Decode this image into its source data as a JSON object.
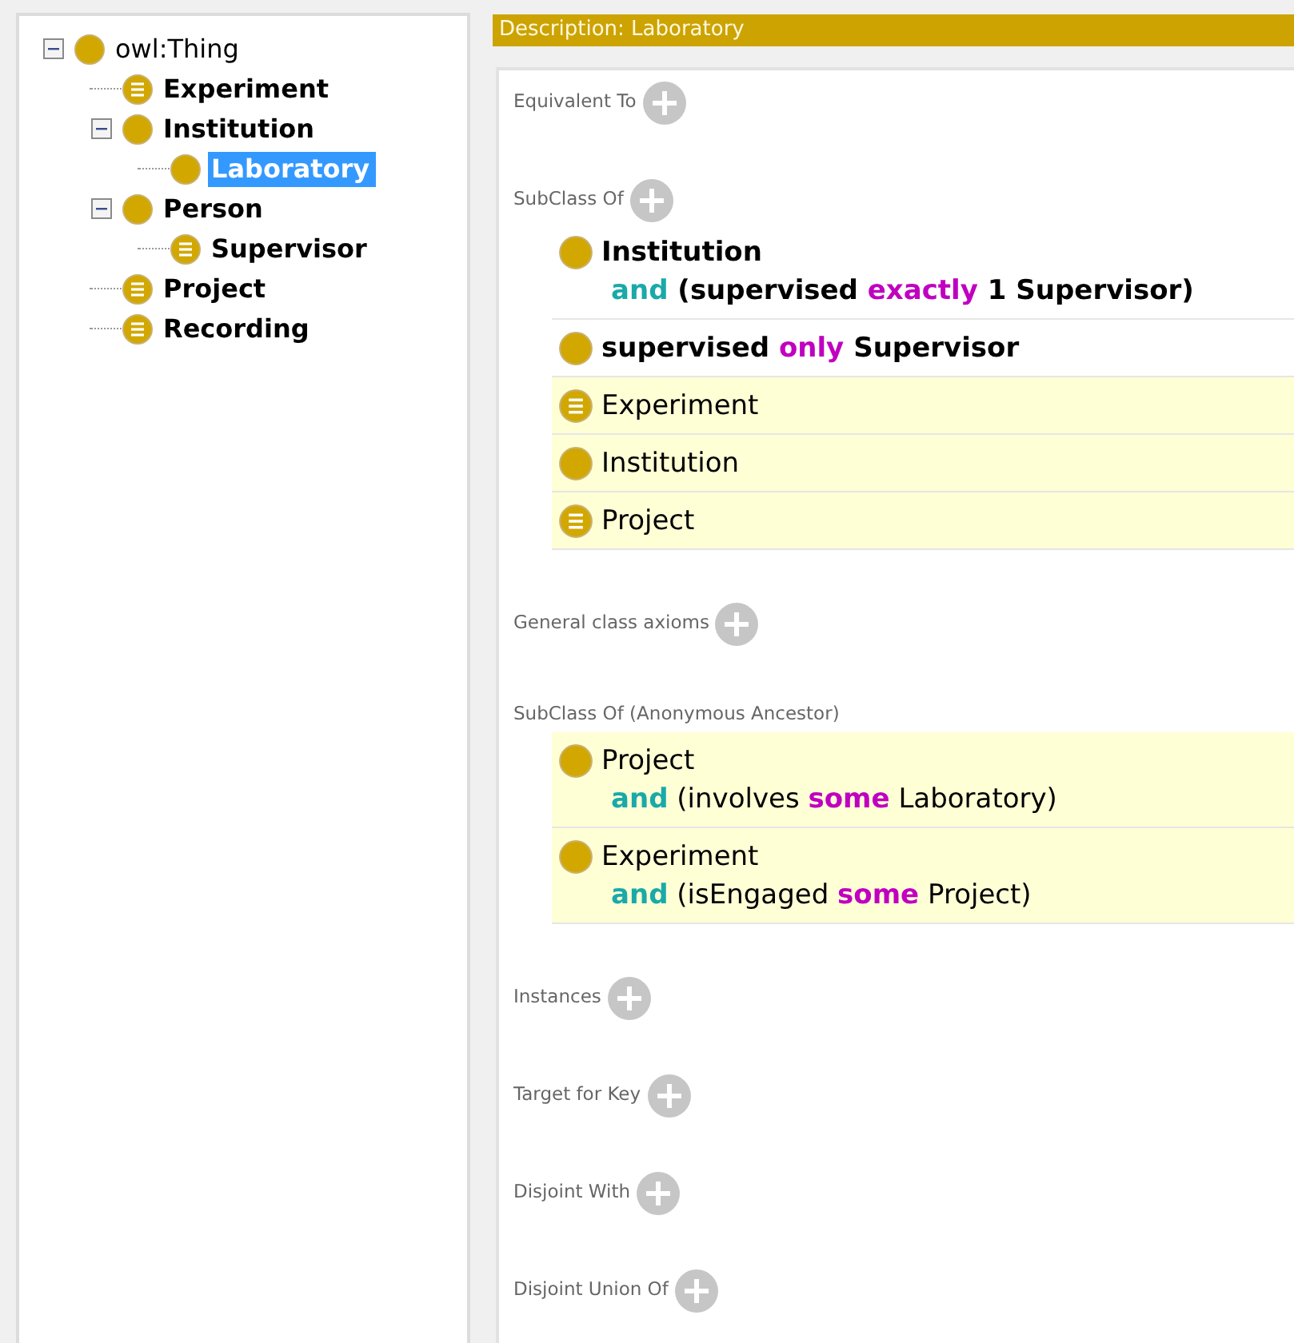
{
  "tree": {
    "label": "owl:Thing",
    "kind": "class",
    "bold": false,
    "selected": false,
    "expanded": true,
    "children": [
      {
        "label": "Experiment",
        "kind": "defined",
        "bold": true,
        "selected": false
      },
      {
        "label": "Institution",
        "kind": "class",
        "bold": true,
        "selected": false,
        "expanded": true,
        "children": [
          {
            "label": "Laboratory",
            "kind": "class",
            "bold": true,
            "selected": true
          }
        ]
      },
      {
        "label": "Person",
        "kind": "class",
        "bold": true,
        "selected": false,
        "expanded": true,
        "children": [
          {
            "label": "Supervisor",
            "kind": "defined",
            "bold": true,
            "selected": false
          }
        ]
      },
      {
        "label": "Project",
        "kind": "defined",
        "bold": true,
        "selected": false
      },
      {
        "label": "Recording",
        "kind": "defined",
        "bold": true,
        "selected": false
      }
    ]
  },
  "description": {
    "title": "Description: Laboratory",
    "sections": [
      {
        "label": "Equivalent To",
        "addable": true
      },
      {
        "label": "SubClass Of",
        "addable": true,
        "items": [
          {
            "kind": "class",
            "inferred": false,
            "bold": true,
            "lines": [
              [
                {
                  "text": "Institution",
                  "kind": "name"
                }
              ],
              [
                {
                  "text": "and",
                  "kind": "connective"
                },
                {
                  "text": " (supervised ",
                  "kind": "name"
                },
                {
                  "text": "exactly",
                  "kind": "restriction"
                },
                {
                  "text": " 1 Supervisor)",
                  "kind": "name"
                }
              ]
            ]
          },
          {
            "kind": "class",
            "inferred": false,
            "bold": true,
            "lines": [
              [
                {
                  "text": "supervised ",
                  "kind": "name"
                },
                {
                  "text": "only",
                  "kind": "restriction"
                },
                {
                  "text": " Supervisor",
                  "kind": "name"
                }
              ]
            ]
          },
          {
            "kind": "defined",
            "inferred": true,
            "bold": false,
            "lines": [
              [
                {
                  "text": "Experiment",
                  "kind": "name"
                }
              ]
            ]
          },
          {
            "kind": "class",
            "inferred": true,
            "bold": false,
            "lines": [
              [
                {
                  "text": "Institution",
                  "kind": "name"
                }
              ]
            ]
          },
          {
            "kind": "defined",
            "inferred": true,
            "bold": false,
            "lines": [
              [
                {
                  "text": "Project",
                  "kind": "name"
                }
              ]
            ]
          }
        ]
      },
      {
        "label": "General class axioms",
        "addable": true
      },
      {
        "label": "SubClass Of (Anonymous Ancestor)",
        "addable": false,
        "items": [
          {
            "kind": "class",
            "inferred": true,
            "bold": false,
            "lines": [
              [
                {
                  "text": "Project",
                  "kind": "name"
                }
              ],
              [
                {
                  "text": "and",
                  "kind": "connective"
                },
                {
                  "text": " (involves ",
                  "kind": "name"
                },
                {
                  "text": "some",
                  "kind": "restriction"
                },
                {
                  "text": " Laboratory)",
                  "kind": "name"
                }
              ]
            ]
          },
          {
            "kind": "class",
            "inferred": true,
            "bold": false,
            "lines": [
              [
                {
                  "text": "Experiment",
                  "kind": "name"
                }
              ],
              [
                {
                  "text": "and",
                  "kind": "connective"
                },
                {
                  "text": " (isEngaged ",
                  "kind": "name"
                },
                {
                  "text": "some",
                  "kind": "restriction"
                },
                {
                  "text": " Project)",
                  "kind": "name"
                }
              ]
            ]
          }
        ]
      },
      {
        "label": "Instances",
        "addable": true
      },
      {
        "label": "Target for Key",
        "addable": true
      },
      {
        "label": "Disjoint With",
        "addable": true
      },
      {
        "label": "Disjoint Union Of",
        "addable": true
      }
    ]
  }
}
